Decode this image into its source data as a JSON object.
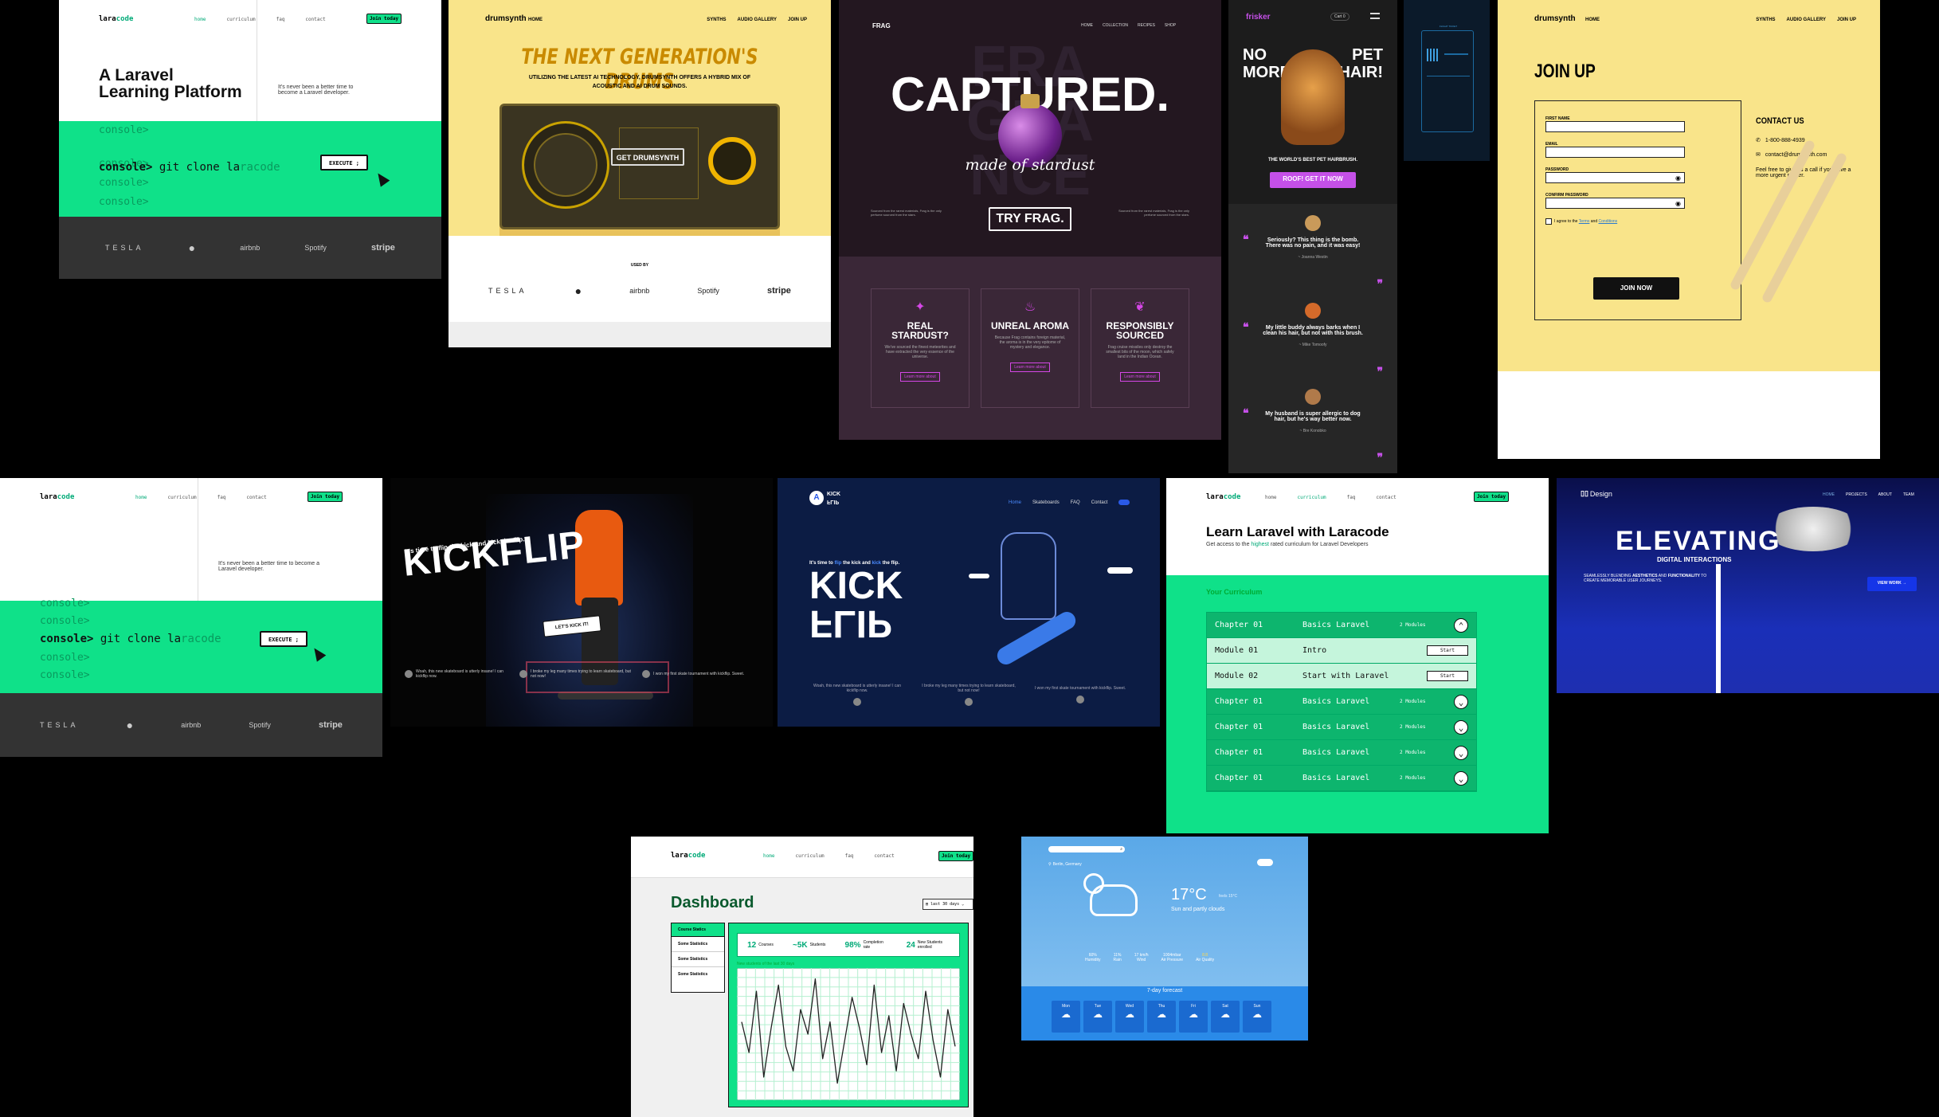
{
  "laracode1": {
    "logo_a": "lara",
    "logo_b": "code",
    "nav": [
      "home",
      "curriculum",
      "faq",
      "contact"
    ],
    "cta": "Join today",
    "title": "A Laravel Learning Platform",
    "tagline": "It's never been a better time to become a Laravel developer.",
    "console_ghost": [
      "console>",
      "console>",
      "console>",
      "console>"
    ],
    "prompt": "console>",
    "cmd_a": "git clone la",
    "cmd_b": "racode",
    "execute": "EXECUTE ;",
    "logos": [
      "TESLA",
      "",
      "airbnb",
      "Spotify",
      "stripe"
    ]
  },
  "drumsynth1": {
    "logo": "drumsynth",
    "nav": [
      "HOME",
      "SYNTHS",
      "AUDIO GALLERY",
      "JOIN UP"
    ],
    "headline": "THE NEXT GENERATION'S DRUMS",
    "sub": "UTILIZING THE LATEST AI TECHNOLOGY, DRUMSYNTH OFFERS A HYBRID MIX OF ACOUSTIC AND AI DRUM SOUNDS.",
    "cta": "GET DRUMSYNTH",
    "used_by": "USED BY",
    "logos": [
      "TESLA",
      "",
      "airbnb",
      "Spotify",
      "stripe"
    ]
  },
  "frag": {
    "logo": "FRAG",
    "nav": [
      "HOME",
      "COLLECTION",
      "RECIPES",
      "SHOP"
    ],
    "ghost": "FRAGRANCE",
    "headline": "CAPTURED.",
    "script": "made of stardust",
    "cta": "TRY FRAG.",
    "side_left": "Sourced from the rarest materials, Frag is the only perfume sourced from the stars.",
    "side_right": "Sourced from the rarest materials, Frag is the only perfume sourced from the stars.",
    "features": [
      {
        "title": "REAL STARDUST?",
        "text": "We've sourced the finest meteorites and have extracted the very essence of the universe.",
        "link": "Learn more about"
      },
      {
        "title": "UNREAL AROMA",
        "text": "Because Frag contains foreign material, the aroma is in the very epitome of mystery and elegance.",
        "link": "Learn more about"
      },
      {
        "title": "RESPONSIBLY SOURCED",
        "text": "Frag cruise missiles only destroy the smallest bits of the moon, which safely land in the Indian Ocean.",
        "link": "Learn more about"
      }
    ]
  },
  "frisker": {
    "logo": "frisker",
    "cart": "Cart 0",
    "headline": [
      "NO",
      "PET",
      "MORE",
      "HAIR!"
    ],
    "tagline": "THE WORLD'S BEST PET HAIRBRUSH.",
    "cta": "ROOF! GET IT NOW",
    "testimonials": [
      {
        "quote": "Seriously? This thing is the bomb. There was no pain, and it was easy!",
        "author": "~ Joanna Westin"
      },
      {
        "quote": "My little buddy always barks when I clean his hair, but not with this brush.",
        "author": "~ Mike Tomoofy"
      },
      {
        "quote": "My husband is super allergic to dog hair, but he's way better now.",
        "author": "~ Bre Konobko"
      }
    ]
  },
  "tiny": {
    "text": "FLIGHT TICKET"
  },
  "drumsynth2": {
    "logo": "drumsynth",
    "nav": [
      "HOME",
      "SYNTHS",
      "AUDIO GALLERY",
      "JOIN UP"
    ],
    "title": "JOIN UP",
    "fields": [
      "FIRST NAME",
      "EMAIL",
      "PASSWORD",
      "CONFIRM PASSWORD"
    ],
    "agree_a": "I agree to the ",
    "terms": "Terms",
    "agree_b": " and ",
    "conditions": "Conditions",
    "submit": "JOIN NOW",
    "contact_title": "CONTACT US",
    "phone": "1-800-888-4939",
    "email": "contact@drumsynth.com",
    "contact_note": "Feel free to give us a call if you have a more urgent matter."
  },
  "laracode2": {
    "logo_a": "lara",
    "logo_b": "code",
    "nav": [
      "home",
      "curriculum",
      "faq",
      "contact"
    ],
    "cta": "Join today",
    "tagline": "It's never been a better time to become a Laravel developer.",
    "console_ghost": [
      "console>",
      "console>",
      "console>",
      "console>",
      "console>"
    ],
    "prompt": "console>",
    "cmd_a": "git clone la",
    "cmd_b": "racode",
    "execute": "EXECUTE ;",
    "logos": [
      "TESLA",
      "",
      "airbnb",
      "Spotify",
      "stripe"
    ]
  },
  "kickflip1": {
    "over": "It's time to flip the kick and kick the flip.",
    "headline": "KICKFLIP",
    "cta": "LET'S KICK IT!",
    "quotes": [
      "Woah, this new skateboard is utterly insane! I can kickflip now.",
      "I broke my leg many times trying to learn skateboard, but not now!",
      "I won my first skate tournament with kickflip. Sweet."
    ]
  },
  "kickflip2": {
    "logo_a": "KICK",
    "logo_b": "FLIP",
    "nav": [
      "Home",
      "Skateboards",
      "FAQ",
      "Contact"
    ],
    "over_a": "It's time to ",
    "flip": "flip",
    "over_b": " the kick and ",
    "kick": "kick",
    "over_c": " the flip.",
    "line1": "KICK",
    "line2": "FLIP",
    "quotes": [
      "Woah, this new skateboard is utterly insane! I can kickflip now.",
      "I broke my leg many times trying to learn skateboard, but not now!",
      "I won my first skate tournament with kickflip. Sweet."
    ]
  },
  "laracode3": {
    "logo_a": "lara",
    "logo_b": "code",
    "nav": [
      "home",
      "curriculum",
      "faq",
      "contact"
    ],
    "cta": "Join today",
    "title": "Learn Laravel with Laracode",
    "sub_a": "Get access to the ",
    "sub_hl": "highest",
    "sub_b": " rated curriculum for Laravel Developers",
    "curr_title": "Your Curriculum",
    "rows": [
      {
        "k": "chapter",
        "a": "Chapter 01",
        "b": "Basics Laravel",
        "c": "2 Modules",
        "icon": "up"
      },
      {
        "k": "module",
        "a": "Module 01",
        "b": "Intro",
        "c": "Start"
      },
      {
        "k": "module",
        "a": "Module 02",
        "b": "Start with Laravel",
        "c": "Start"
      },
      {
        "k": "chapter",
        "a": "Chapter 01",
        "b": "Basics Laravel",
        "c": "2 Modules",
        "icon": "down"
      },
      {
        "k": "chapter",
        "a": "Chapter 01",
        "b": "Basics Laravel",
        "c": "2 Modules",
        "icon": "down"
      },
      {
        "k": "chapter",
        "a": "Chapter 01",
        "b": "Basics Laravel",
        "c": "2 Modules",
        "icon": "down"
      },
      {
        "k": "chapter",
        "a": "Chapter 01",
        "b": "Basics Laravel",
        "c": "2 Modules",
        "icon": "down"
      }
    ]
  },
  "design": {
    "logo": "Design",
    "nav": [
      "HOME",
      "PROJECTS",
      "ABOUT",
      "TEAM"
    ],
    "headline": "ELEVATING",
    "sub": "DIGITAL INTERACTIONS",
    "text_a": "SEAMLESSLY BLENDING ",
    "aes": "AESTHETICS",
    "text_b": " AND ",
    "func": "FUNCTIONALITY",
    "text_c": " TO CREATE MEMORABLE USER JOURNEYS.",
    "cta": "VIEW WORK →"
  },
  "dashboard": {
    "logo_a": "lara",
    "logo_b": "code",
    "nav": [
      "home",
      "curriculum",
      "faq",
      "contact"
    ],
    "cta": "Join today",
    "title": "Dashboard",
    "range": "last 30 days",
    "menu": [
      "Course Statics",
      "Some Statistics",
      "Some Statistics",
      "Some Statistics"
    ],
    "stats": [
      {
        "v": "12",
        "l": "Courses"
      },
      {
        "v": "~5K",
        "l": "Students"
      },
      {
        "v": "98%",
        "l": "Completion rate"
      },
      {
        "v": "24",
        "l": "New Students enrolled"
      }
    ],
    "chart_label": "New students of the last 30 days"
  },
  "weather": {
    "location": "Berlin, Germany",
    "temp": "17°C",
    "feels": "feels 15°C",
    "cond": "Sun and partly clouds",
    "metrics": [
      {
        "v": "60%",
        "l": "Humidity"
      },
      {
        "v": "11%",
        "l": "Rain"
      },
      {
        "v": "17 km/h",
        "l": "Wind"
      },
      {
        "v": "1004mbar",
        "l": "Air Pressure"
      },
      {
        "v": "8.8",
        "l": "Air Quality"
      }
    ],
    "forecast_title": "7-day forecast",
    "days": [
      "Mon",
      "Tue",
      "Wed",
      "Thu",
      "Fri",
      "Sat",
      "Sun"
    ]
  },
  "chart_data": {
    "type": "line",
    "x": [
      0,
      1,
      2,
      3,
      4,
      5,
      6,
      7,
      8,
      9,
      10,
      11,
      12,
      13,
      14,
      15,
      16,
      17,
      18,
      19,
      20,
      21,
      22,
      23,
      24,
      25,
      26,
      27,
      28,
      29
    ],
    "y": [
      0.6,
      0.35,
      0.85,
      0.15,
      0.55,
      0.9,
      0.4,
      0.2,
      0.7,
      0.5,
      0.95,
      0.3,
      0.6,
      0.1,
      0.45,
      0.8,
      0.55,
      0.25,
      0.9,
      0.35,
      0.65,
      0.2,
      0.75,
      0.5,
      0.3,
      0.85,
      0.45,
      0.15,
      0.7,
      0.4
    ]
  }
}
